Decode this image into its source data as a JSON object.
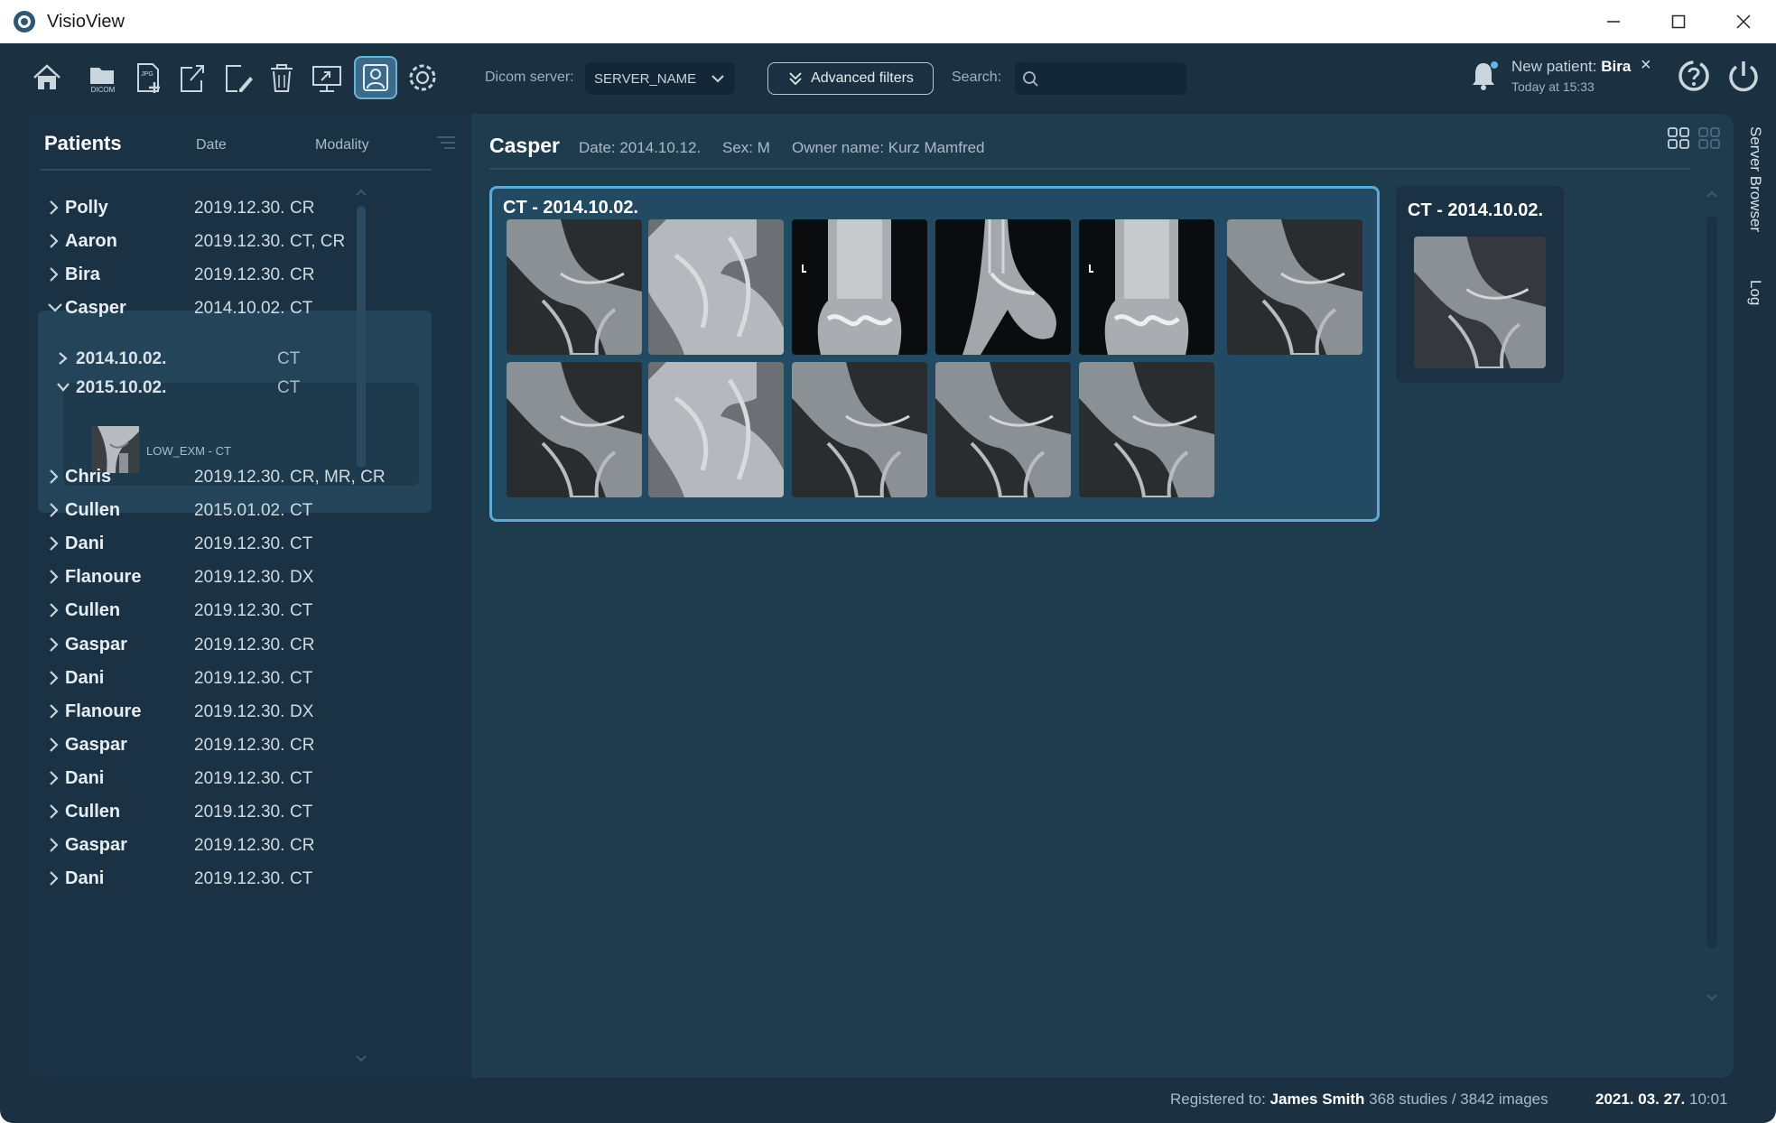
{
  "window": {
    "title": "VisioView"
  },
  "toolbar": {
    "dicom_server_label": "Dicom server:",
    "dicom_server_value": "SERVER_NAME",
    "advanced_filters_label": "Advanced filters",
    "search_label": "Search:",
    "search_value": "",
    "icons": [
      "home-icon",
      "dicom-folder-icon",
      "jpg-import-icon",
      "export-icon",
      "edit-icon",
      "delete-icon",
      "presentation-icon",
      "patient-icon",
      "settings-icon"
    ],
    "icon_text": {
      "dicom": "DICOM",
      "jpg": "JPG"
    }
  },
  "notification": {
    "prefix": "New patient: ",
    "patient": "Bira",
    "time": "Today at 15:33"
  },
  "sidebar": {
    "title": "Patients",
    "col_date": "Date",
    "col_modality": "Modality",
    "patients_top": [
      {
        "name": "Polly",
        "date": "2019.12.30.",
        "modality": "CR"
      },
      {
        "name": "Aaron",
        "date": "2019.12.30.",
        "modality": "CT, CR"
      },
      {
        "name": "Bira",
        "date": "2019.12.30.",
        "modality": "CR"
      },
      {
        "name": "Casper",
        "date": "2014.10.02.",
        "modality": "CT"
      }
    ],
    "studies": [
      {
        "date": "2014.10.02.",
        "modality": "CT"
      },
      {
        "date": "2015.10.02.",
        "modality": "CT"
      }
    ],
    "series_label": "LOW_EXM - CT",
    "patients_bottom": [
      {
        "name": "Chris",
        "date": "2019.12.30.",
        "modality": "CR, MR, CR"
      },
      {
        "name": "Cullen",
        "date": "2015.01.02.",
        "modality": "CT"
      },
      {
        "name": "Dani",
        "date": "2019.12.30.",
        "modality": "CT"
      },
      {
        "name": "Flanoure",
        "date": "2019.12.30.",
        "modality": "DX"
      },
      {
        "name": "Cullen",
        "date": "2019.12.30.",
        "modality": "CT"
      },
      {
        "name": "Gaspar",
        "date": "2019.12.30.",
        "modality": "CR"
      },
      {
        "name": "Dani",
        "date": "2019.12.30.",
        "modality": "CT"
      },
      {
        "name": "Flanoure",
        "date": "2019.12.30.",
        "modality": "DX"
      },
      {
        "name": "Gaspar",
        "date": "2019.12.30.",
        "modality": "CR"
      },
      {
        "name": "Dani",
        "date": "2019.12.30.",
        "modality": "CT"
      },
      {
        "name": "Cullen",
        "date": "2019.12.30.",
        "modality": "CT"
      },
      {
        "name": "Gaspar",
        "date": "2019.12.30.",
        "modality": "CR"
      },
      {
        "name": "Dani",
        "date": "2019.12.30.",
        "modality": "CT"
      }
    ]
  },
  "content": {
    "patient_name": "Casper",
    "date_text": "Date: 2014.10.12.",
    "sex_text": "Sex: M",
    "owner_text": "Owner name: Kurz Mamfred",
    "series1_title": "CT - 2014.10.02.",
    "series2_title": "CT - 2014.10.02."
  },
  "right_tabs": {
    "server_browser": "Server Browser",
    "log": "Log"
  },
  "status": {
    "registered_prefix": "Registered to: ",
    "registered_name": "James Smith",
    "counts": " 368 studies / 3842 images",
    "date": "2021. 03. 27.",
    "time": " 10:01"
  },
  "colors": {
    "background": "#1b3142",
    "panel": "#1f3b4e",
    "accent": "#5fa9d6"
  }
}
